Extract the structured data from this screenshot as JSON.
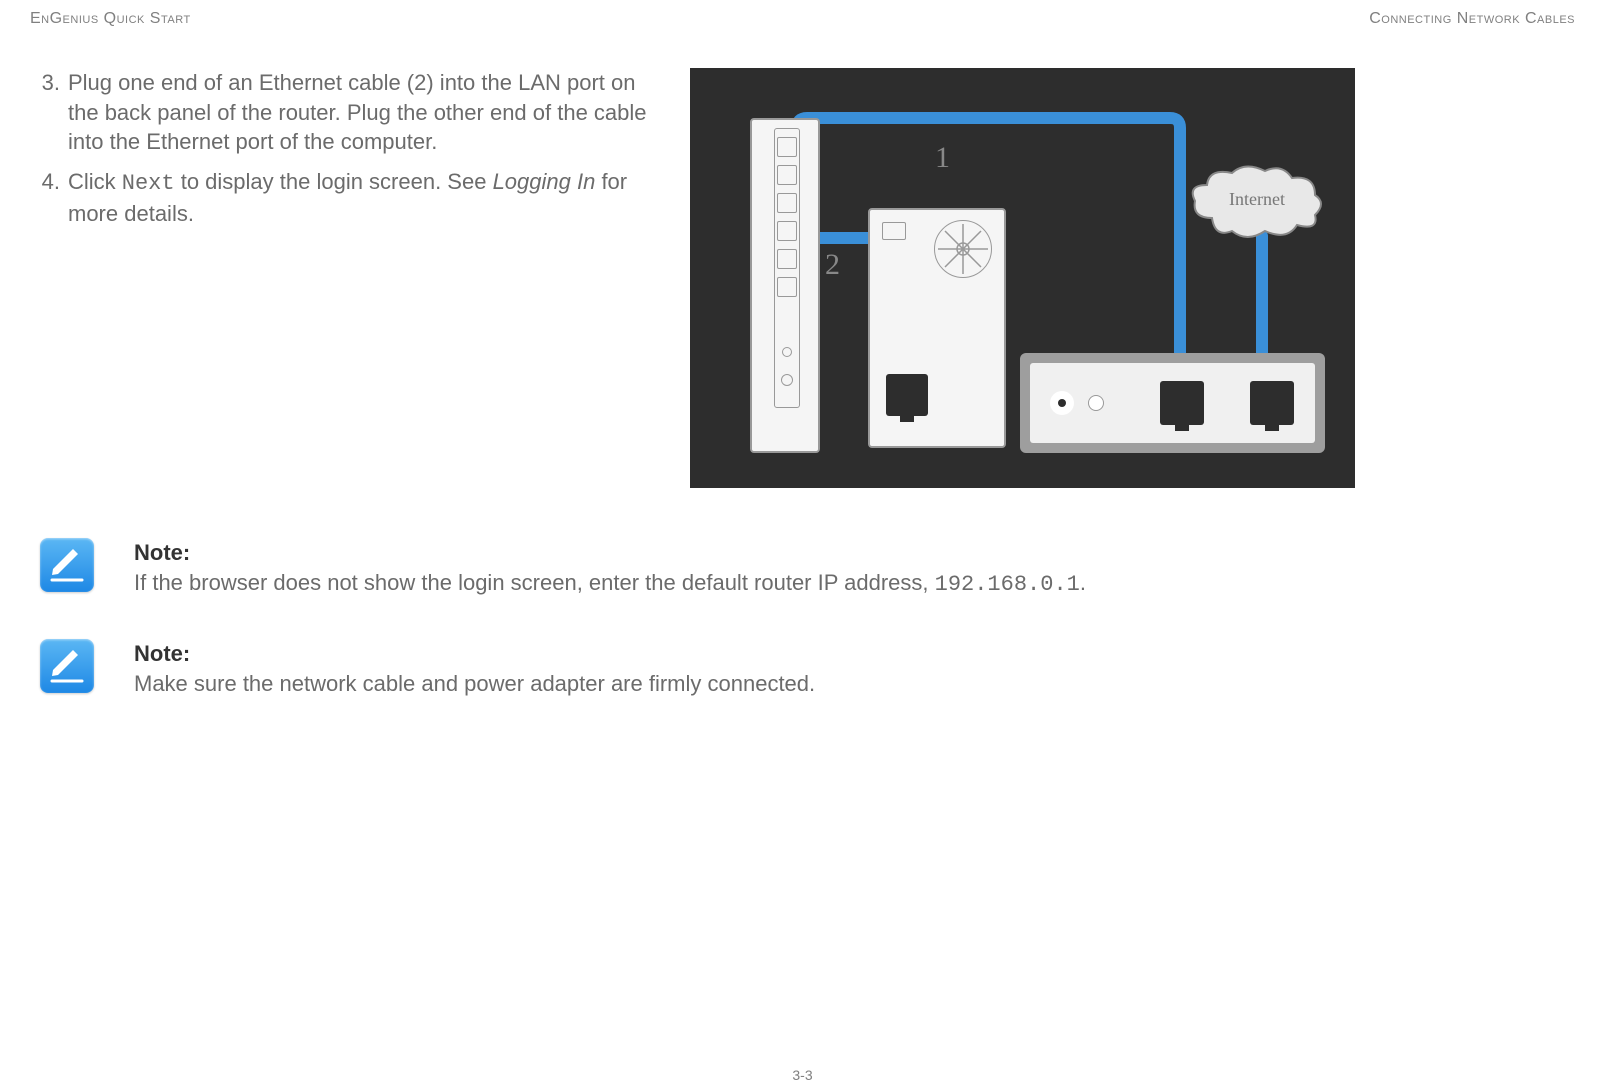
{
  "header": {
    "left": "EnGenius Quick Start",
    "right": "Connecting Network Cables"
  },
  "steps": [
    {
      "number": "3.",
      "text_parts": [
        "Plug one end of an Ethernet cable (2) into the LAN port on the back panel of the router. Plug the other end of the cable into the Ethernet port of the computer."
      ]
    },
    {
      "number": "4.",
      "prefix": "Click ",
      "mono": "Next",
      "mid": " to display the login screen. See ",
      "italic": "Logging In",
      "suffix": " for more details."
    }
  ],
  "diagram": {
    "label1": "1",
    "label2": "2",
    "cloud_label": "Internet"
  },
  "notes": [
    {
      "title": "Note:",
      "text_prefix": "If the browser does not show the login screen, enter the default router IP address, ",
      "mono": "192.168.0.1",
      "text_suffix": "."
    },
    {
      "title": "Note:",
      "text_prefix": "Make sure the network cable and power adapter are firmly connected.",
      "mono": "",
      "text_suffix": ""
    }
  ],
  "footer": "3-3"
}
